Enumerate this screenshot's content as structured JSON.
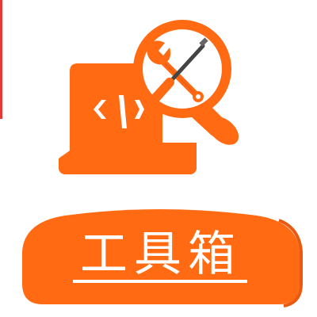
{
  "icon": {
    "name": "toolbox-icon",
    "accent_color": "#ff6a13",
    "components": [
      "laptop-icon",
      "magnifier-icon",
      "wrench-icon",
      "screwdriver-icon",
      "code-icon"
    ]
  },
  "label": {
    "text": "工具箱",
    "text_color": "#ffffff",
    "background_color": "#ff6a13"
  }
}
